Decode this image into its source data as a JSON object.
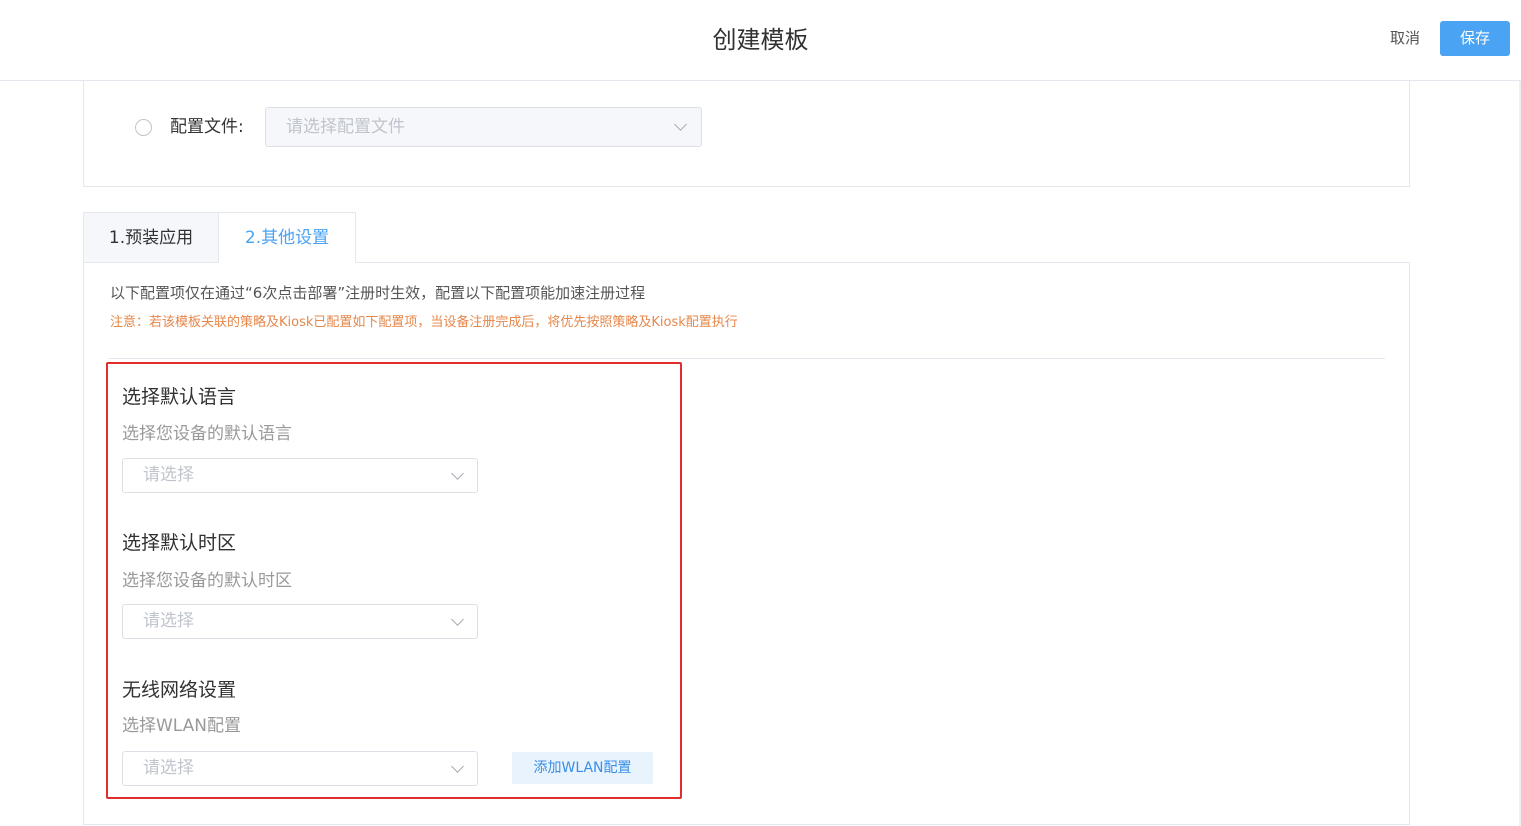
{
  "header": {
    "title": "创建模板",
    "cancel_label": "取消",
    "save_label": "保存"
  },
  "config_file": {
    "label": "配置文件:",
    "placeholder": "请选择配置文件"
  },
  "tabs": [
    {
      "label": "1.预装应用",
      "active": false
    },
    {
      "label": "2.其他设置",
      "active": true
    }
  ],
  "panel": {
    "info": "以下配置项仅在通过“6次点击部署”注册时生效，配置以下配置项能加速注册过程",
    "notice": "注意：若该模板关联的策略及Kiosk已配置如下配置项，当设备注册完成后，将优先按照策略及Kiosk配置执行"
  },
  "sections": {
    "language": {
      "title": "选择默认语言",
      "desc": "选择您设备的默认语言",
      "placeholder": "请选择"
    },
    "timezone": {
      "title": "选择默认时区",
      "desc": "选择您设备的默认时区",
      "placeholder": "请选择"
    },
    "wlan": {
      "title": "无线网络设置",
      "desc": "选择WLAN配置",
      "placeholder": "请选择",
      "add_label": "添加WLAN配置"
    }
  },
  "colors": {
    "primary": "#4aa3f3",
    "notice": "#e6874a",
    "highlight_border": "#e02d2d"
  },
  "icons": {
    "select_arrow": "chevron-down-icon",
    "radio": "radio-unchecked-icon"
  }
}
